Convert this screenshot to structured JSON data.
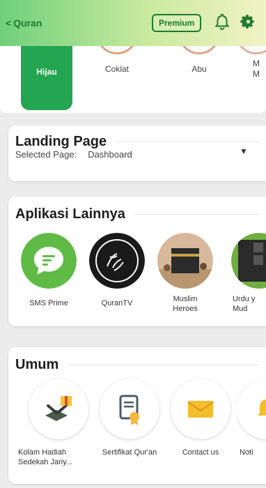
{
  "header": {
    "back_label": "Quran",
    "premium_label": "Premium",
    "colors": {
      "accent": "#23a552",
      "header_start": "#6fd07a",
      "header_end": "#f2f2c6"
    }
  },
  "themes": {
    "items": [
      {
        "label": "Hijau",
        "color": "#23a552",
        "selected": true
      },
      {
        "label": "Coklat",
        "color": "#e0a37a"
      },
      {
        "label": "Abu",
        "color": "#d9a48a"
      },
      {
        "label": "M\nM",
        "color": "#d8b5a0"
      }
    ]
  },
  "landing": {
    "title": "Landing Page",
    "selected_label": "Selected Page:",
    "selected_value": "Dashboard"
  },
  "apps": {
    "title": "Aplikasi Lainnya",
    "items": [
      {
        "label": "SMS Prime",
        "icon": "sms-prime-icon"
      },
      {
        "label": "QuranTV",
        "icon": "quran-tv-icon"
      },
      {
        "label": "Muslim\nHeroes",
        "icon": "muslim-heroes-icon"
      },
      {
        "label": "Urdu y\nMud",
        "icon": "urdu-app-icon"
      }
    ]
  },
  "umum": {
    "title": "Umum",
    "items": [
      {
        "label": "Kolam Hadiah\nSedekah Jariy...",
        "icon": "quran-gift-icon"
      },
      {
        "label": "Sertifikat Qur'an",
        "icon": "certificate-icon"
      },
      {
        "label": "Contact us",
        "icon": "envelope-icon"
      },
      {
        "label": "Noti",
        "icon": "notification-icon"
      }
    ]
  }
}
